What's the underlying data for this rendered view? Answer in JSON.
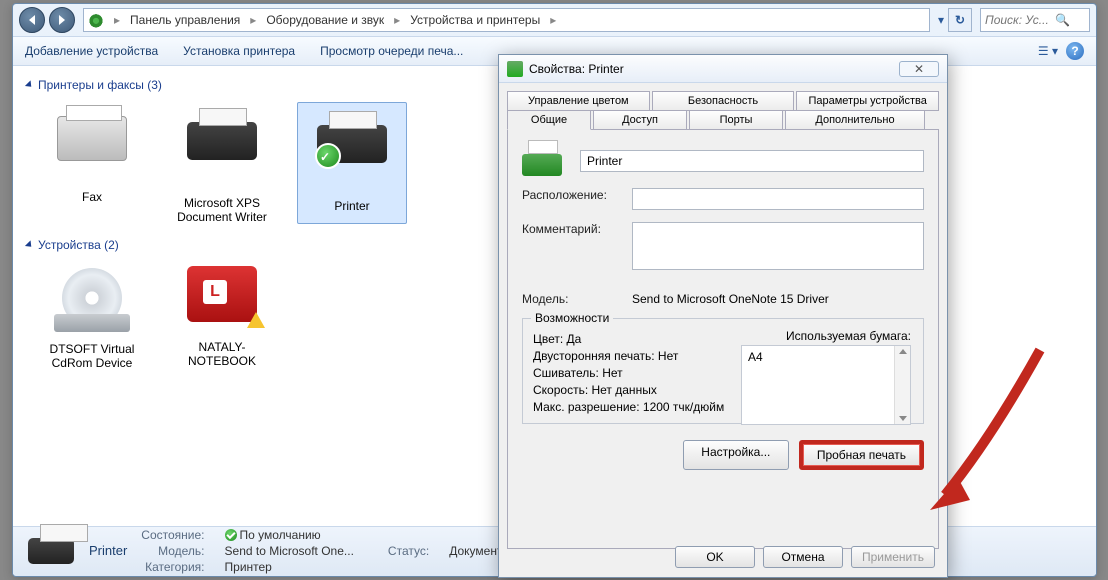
{
  "breadcrumb": {
    "seg1": "Панель управления",
    "seg2": "Оборудование и звук",
    "seg3": "Устройства и принтеры"
  },
  "search": {
    "placeholder": "Поиск: Ус..."
  },
  "toolbar": {
    "add_device": "Добавление устройства",
    "add_printer": "Установка принтера",
    "view_queue": "Просмотр очереди печа..."
  },
  "groups": {
    "printers_fax": "Принтеры и факсы (3)",
    "devices": "Устройства (2)"
  },
  "items": {
    "fax": "Fax",
    "xps": "Microsoft XPS Document Writer",
    "printer": "Printer",
    "dtsoft": "DTSOFT Virtual CdRom Device",
    "nataly": "NATALY-NOTEBOOK"
  },
  "status": {
    "name": "Printer",
    "state_k": "Состояние:",
    "state_v": "По умолчанию",
    "model_k": "Модель:",
    "model_v": "Send to Microsoft One...",
    "cat_k": "Категория:",
    "cat_v": "Принтер",
    "status_k": "Статус:",
    "status_v": "Документов..."
  },
  "dialog": {
    "title": "Свойства: Printer",
    "tabs_top": {
      "color": "Управление цветом",
      "security": "Безопасность",
      "device": "Параметры устройства"
    },
    "tabs_bottom": {
      "general": "Общие",
      "sharing": "Доступ",
      "ports": "Порты",
      "advanced": "Дополнительно"
    },
    "printer_name": "Printer",
    "location_k": "Расположение:",
    "comment_k": "Комментарий:",
    "model_k": "Модель:",
    "model_v": "Send to Microsoft OneNote 15 Driver",
    "caps_title": "Возможности",
    "caps": {
      "color": "Цвет: Да",
      "duplex": "Двусторонняя печать: Нет",
      "staple": "Сшиватель: Нет",
      "speed": "Скорость: Нет данных",
      "maxres": "Макс. разрешение: 1200 тчк/дюйм"
    },
    "paper_title": "Используемая бумага:",
    "paper_size": "A4",
    "btn_prefs": "Настройка...",
    "btn_test": "Пробная печать",
    "btn_ok": "OK",
    "btn_cancel": "Отмена",
    "btn_apply": "Применить"
  }
}
